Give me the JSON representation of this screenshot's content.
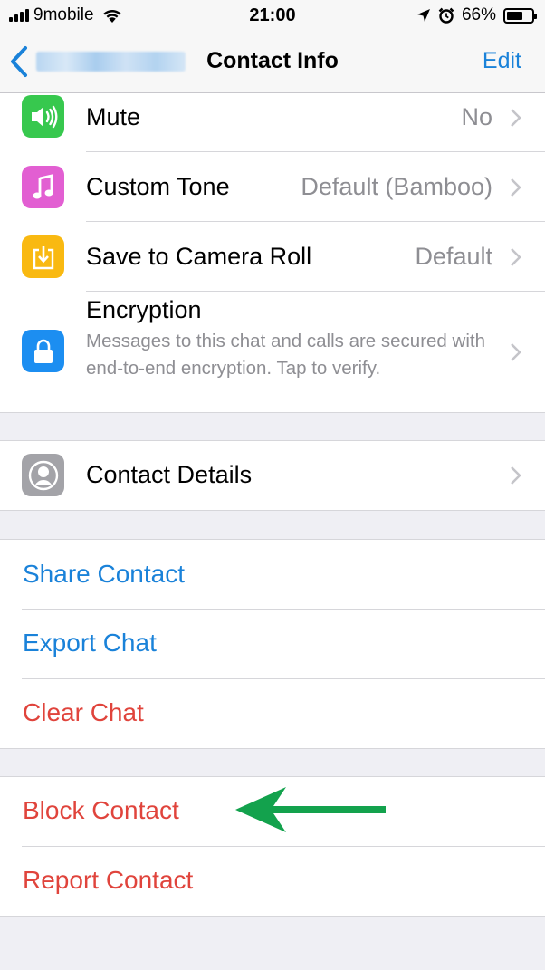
{
  "status_bar": {
    "carrier": "9mobile",
    "time": "21:00",
    "battery_percent_label": "66%",
    "battery_level": 0.66
  },
  "nav": {
    "title": "Contact Info",
    "edit_label": "Edit",
    "back_icon": "chevron-left-icon"
  },
  "settings": {
    "mute": {
      "label": "Mute",
      "value": "No",
      "icon": "speaker-icon",
      "color": "#37c84e"
    },
    "custom_tone": {
      "label": "Custom Tone",
      "value": "Default (Bamboo)",
      "icon": "music-note-icon",
      "color": "#e25fd2"
    },
    "save_camera_roll": {
      "label": "Save to Camera Roll",
      "value": "Default",
      "icon": "download-icon",
      "color": "#f9b911"
    },
    "encryption": {
      "label": "Encryption",
      "description": "Messages to this chat and calls are secured with end-to-end encryption. Tap to verify.",
      "icon": "lock-icon",
      "color": "#1c8ef1"
    }
  },
  "contact_details": {
    "label": "Contact Details",
    "icon": "person-icon",
    "color": "#a3a3a8"
  },
  "actions": {
    "share_contact": "Share Contact",
    "export_chat": "Export Chat",
    "clear_chat": "Clear Chat"
  },
  "danger": {
    "block_contact": "Block Contact",
    "report_contact": "Report Contact"
  },
  "annotation": {
    "icon": "arrow-left-icon",
    "color": "#13a24d"
  },
  "colors": {
    "link_blue": "#1a82d9",
    "destructive_red": "#e0443c",
    "secondary_text": "#8e8e93"
  }
}
